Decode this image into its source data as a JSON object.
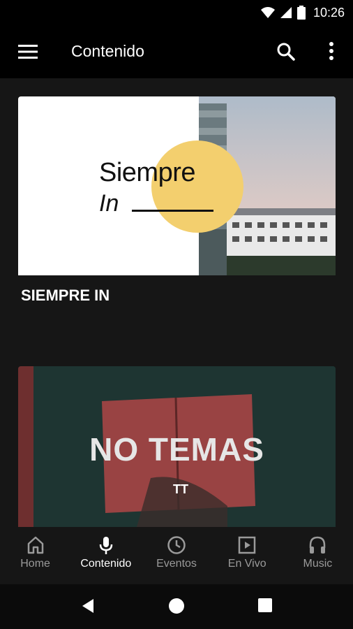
{
  "status": {
    "time": "10:26"
  },
  "appbar": {
    "title": "Contenido"
  },
  "cards": [
    {
      "label": "SIEMPRE IN",
      "brand_line1": "Siempre",
      "brand_line2": "In"
    },
    {
      "title": "NO TEMAS",
      "logo": "TT"
    }
  ],
  "nav": {
    "home": "Home",
    "contenido": "Contenido",
    "eventos": "Eventos",
    "envivo": "En Vivo",
    "music": "Music"
  },
  "colors": {
    "accent_circle": "#f3cf6e",
    "card2_bg": "#1e3532",
    "book_red": "#b34a4a"
  }
}
